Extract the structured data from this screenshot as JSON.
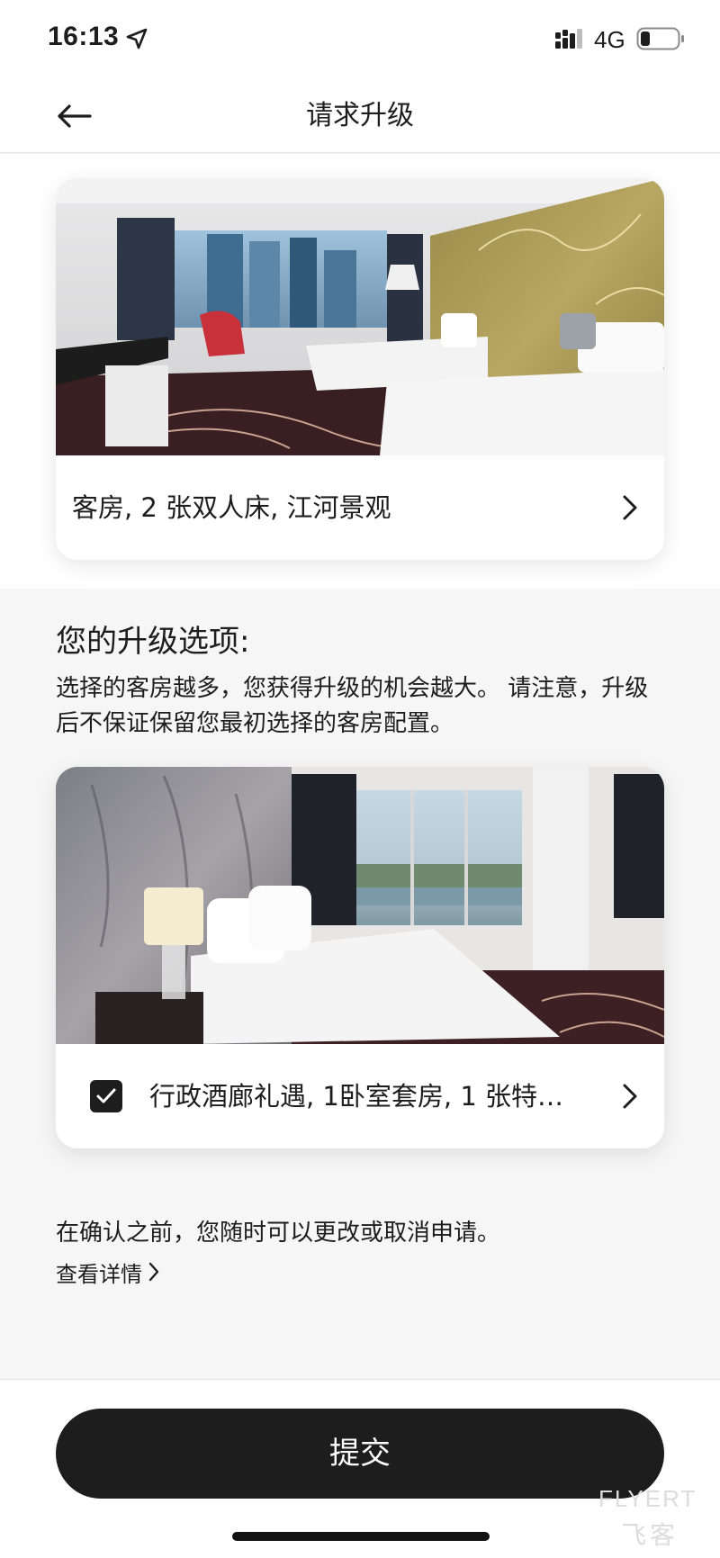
{
  "status_bar": {
    "time": "16:13",
    "network": "4G",
    "icons": [
      "location-arrow-icon",
      "signal-icon",
      "battery-icon"
    ]
  },
  "nav": {
    "title": "请求升级",
    "back_icon": "arrow-left-icon"
  },
  "current_room": {
    "label": "客房, 2 张双人床, 江河景观",
    "photo": "hotel-room-two-double-beds-photo"
  },
  "options": {
    "heading": "您的升级选项:",
    "description": "选择的客房越多，您获得升级的机会越大。 请注意，升级后不保证保留您最初选择的客房配置。",
    "rooms": [
      {
        "label": "行政酒廊礼遇, 1卧室套房, 1 张特…",
        "checked": true,
        "photo": "suite-king-bed-river-view-photo"
      }
    ]
  },
  "footer_note": {
    "text": "在确认之前，您随时可以更改或取消申请。",
    "details_link": "查看详情"
  },
  "submit": {
    "label": "提交"
  },
  "watermark": {
    "text": "FLYERT",
    "sub": "飞客"
  },
  "colors": {
    "primary": "#1d1d1d",
    "page_bg": "#f6f6f6",
    "card_bg": "#ffffff"
  }
}
